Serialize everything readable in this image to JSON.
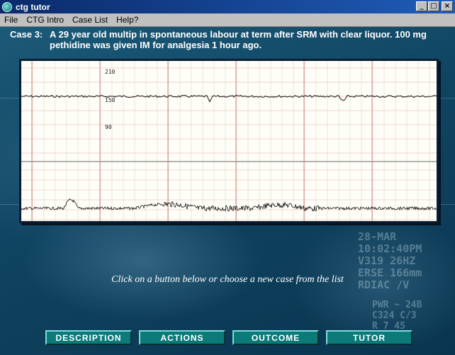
{
  "window": {
    "title": "ctg tutor",
    "minimize_glyph": "_",
    "maximize_glyph": "□",
    "close_glyph": "×",
    "icon": "ctg-app-icon"
  },
  "menu": {
    "items": [
      "File",
      "CTG Intro",
      "Case List",
      "Help?"
    ]
  },
  "case": {
    "label": "Case 3:",
    "description": "A 29 year old multip in spontaneous labour at term after SRM with clear liquor. 100 mg pethidine was given IM for analgesia 1 hour ago."
  },
  "ctg": {
    "fhr_scale_labels": [
      "210",
      "150",
      "90"
    ],
    "paper_color": "#fffdf7",
    "grid_red": "#e48a8a",
    "grid_green": "#8ac88a",
    "trace_color": "#111111"
  },
  "instruction": "Click on a button below or choose a new case from the list",
  "buttons": [
    "DESCRIPTION",
    "ACTIONS",
    "OUTCOME",
    "TUTOR"
  ],
  "colors": {
    "title_bar": "#0a2a6a",
    "button_face": "#0d7a7a",
    "background": "#0f4461"
  }
}
